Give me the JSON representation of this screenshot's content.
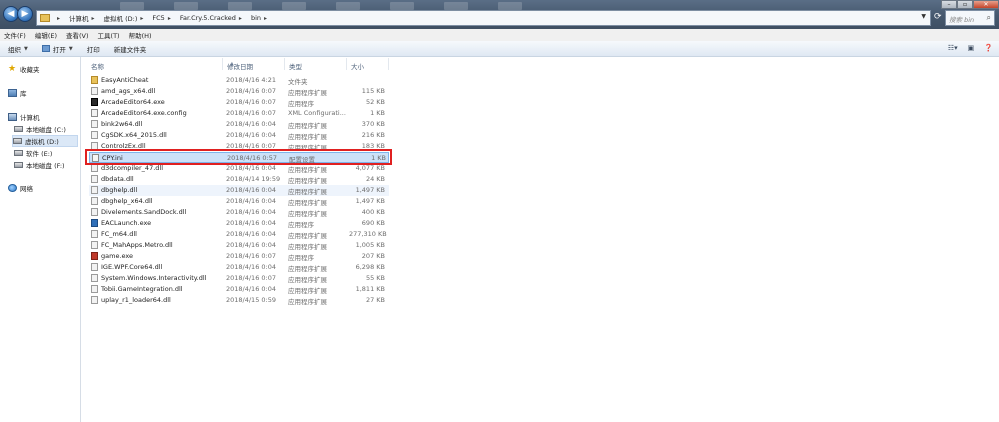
{
  "address": {
    "breadcrumbs": [
      "计算机",
      "虚拟机 (D:)",
      "FC5",
      "Far.Cry.5.Cracked",
      "bin"
    ],
    "search_placeholder": "搜索 bin"
  },
  "menu": [
    "文件(F)",
    "编辑(E)",
    "查看(V)",
    "工具(T)",
    "帮助(H)"
  ],
  "toolbar": {
    "organize": "组织",
    "open": "打开",
    "print": "打印",
    "new_folder": "新建文件夹"
  },
  "sidebar": {
    "favorites": "收藏夹",
    "libraries": "库",
    "computer": "计算机",
    "drives": [
      "本地磁盘 (C:)",
      "虚拟机 (D:)",
      "软件 (E:)",
      "本地磁盘 (F:)"
    ],
    "network": "网络"
  },
  "columns": {
    "name": "名称",
    "date": "修改日期",
    "type": "类型",
    "size": "大小"
  },
  "files": [
    {
      "name": "EasyAntiCheat",
      "date": "2018/4/16 4:21",
      "type": "文件夹",
      "size": "",
      "icon": "folder"
    },
    {
      "name": "amd_ags_x64.dll",
      "date": "2018/4/16 0:07",
      "type": "应用程序扩展",
      "size": "115 KB",
      "icon": "dll"
    },
    {
      "name": "ArcadeEditor64.exe",
      "date": "2018/4/16 0:07",
      "type": "应用程序",
      "size": "52 KB",
      "icon": "exe"
    },
    {
      "name": "ArcadeEditor64.exe.config",
      "date": "2018/4/16 0:07",
      "type": "XML Configurati...",
      "size": "1 KB",
      "icon": "config"
    },
    {
      "name": "bink2w64.dll",
      "date": "2018/4/16 0:04",
      "type": "应用程序扩展",
      "size": "370 KB",
      "icon": "dll"
    },
    {
      "name": "CgSDK.x64_2015.dll",
      "date": "2018/4/16 0:04",
      "type": "应用程序扩展",
      "size": "216 KB",
      "icon": "dll"
    },
    {
      "name": "ControlzEx.dll",
      "date": "2018/4/16 0:07",
      "type": "应用程序扩展",
      "size": "183 KB",
      "icon": "dll"
    },
    {
      "name": "CPY.ini",
      "date": "2018/4/16 0:57",
      "type": "配置设置",
      "size": "1 KB",
      "icon": "ini"
    },
    {
      "name": "d3dcompiler_47.dll",
      "date": "2018/4/16 0:04",
      "type": "应用程序扩展",
      "size": "4,077 KB",
      "icon": "dll"
    },
    {
      "name": "dbdata.dll",
      "date": "2018/4/14 19:59",
      "type": "应用程序扩展",
      "size": "24 KB",
      "icon": "dll"
    },
    {
      "name": "dbghelp.dll",
      "date": "2018/4/16 0:04",
      "type": "应用程序扩展",
      "size": "1,497 KB",
      "icon": "dll"
    },
    {
      "name": "dbghelp_x64.dll",
      "date": "2018/4/16 0:04",
      "type": "应用程序扩展",
      "size": "1,497 KB",
      "icon": "dll"
    },
    {
      "name": "Divelements.SandDock.dll",
      "date": "2018/4/16 0:04",
      "type": "应用程序扩展",
      "size": "400 KB",
      "icon": "dll"
    },
    {
      "name": "EACLaunch.exe",
      "date": "2018/4/16 0:04",
      "type": "应用程序",
      "size": "690 KB",
      "icon": "exe-blue"
    },
    {
      "name": "FC_m64.dll",
      "date": "2018/4/16 0:04",
      "type": "应用程序扩展",
      "size": "277,310 KB",
      "icon": "dll"
    },
    {
      "name": "FC_MahApps.Metro.dll",
      "date": "2018/4/16 0:04",
      "type": "应用程序扩展",
      "size": "1,005 KB",
      "icon": "dll"
    },
    {
      "name": "game.exe",
      "date": "2018/4/16 0:07",
      "type": "应用程序",
      "size": "207 KB",
      "icon": "exe-red"
    },
    {
      "name": "IGE.WPF.Core64.dll",
      "date": "2018/4/16 0:04",
      "type": "应用程序扩展",
      "size": "6,298 KB",
      "icon": "dll"
    },
    {
      "name": "System.Windows.Interactivity.dll",
      "date": "2018/4/16 0:07",
      "type": "应用程序扩展",
      "size": "55 KB",
      "icon": "dll"
    },
    {
      "name": "Tobii.GameIntegration.dll",
      "date": "2018/4/16 0:04",
      "type": "应用程序扩展",
      "size": "1,811 KB",
      "icon": "dll"
    },
    {
      "name": "uplay_r1_loader64.dll",
      "date": "2018/4/15 0:59",
      "type": "应用程序扩展",
      "size": "27 KB",
      "icon": "dll"
    }
  ],
  "selected_file": "CPY.ini",
  "highlight_color": "#e02020"
}
